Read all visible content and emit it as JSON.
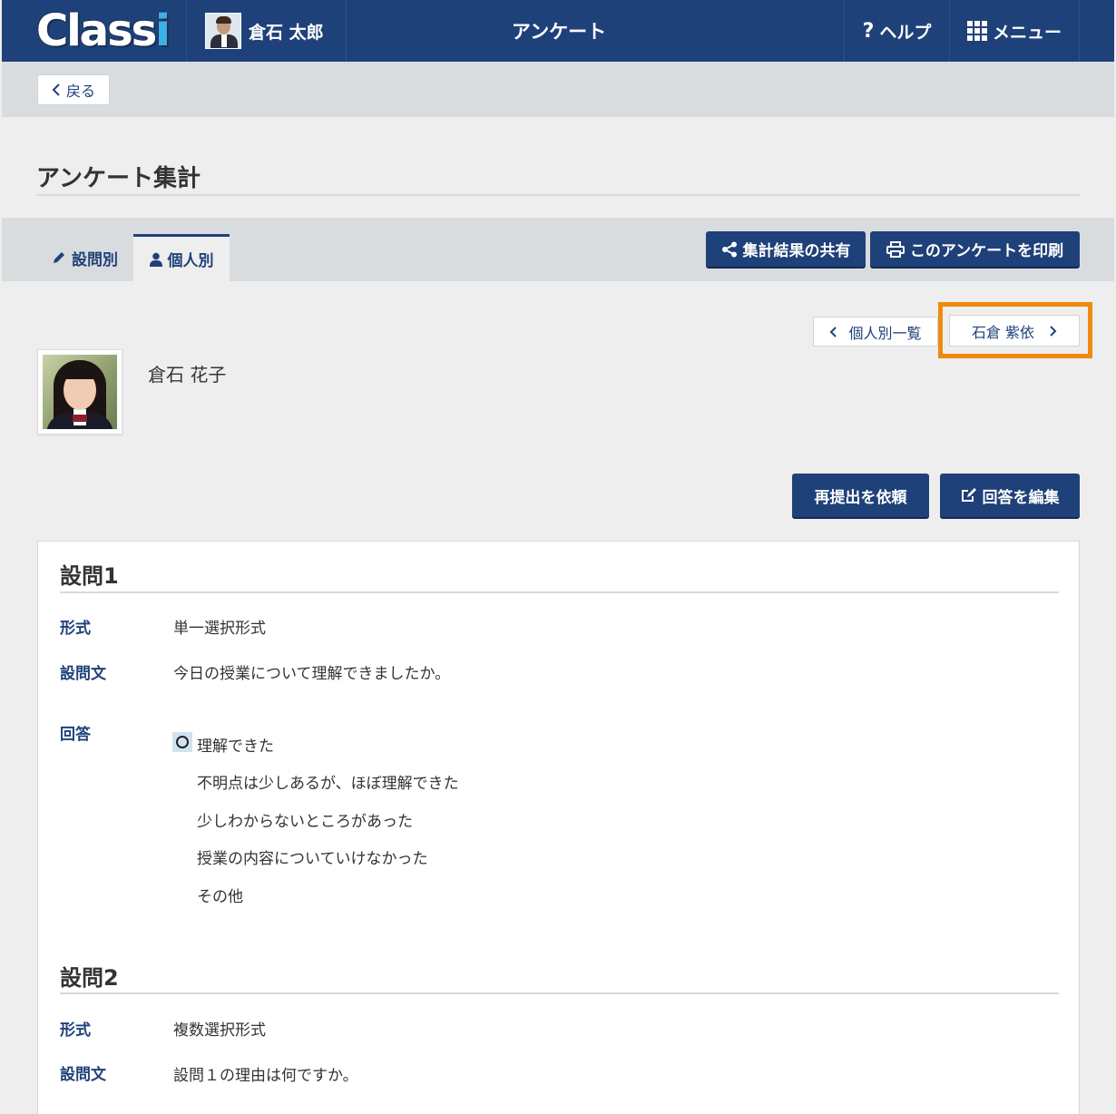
{
  "header": {
    "logo_text_a": "Class",
    "logo_text_b": "i",
    "user_name": "倉石 太郎",
    "page_title": "アンケート",
    "help_icon": "?",
    "help_label": "ヘルプ",
    "menu_label": "メニュー"
  },
  "nav": {
    "back_label": "戻る"
  },
  "page": {
    "title": "アンケート集計"
  },
  "tabs": [
    {
      "label": "設問別",
      "icon": "pencil-icon"
    },
    {
      "label": "個人別",
      "icon": "user-icon"
    }
  ],
  "toolbar": {
    "share_label": "集計結果の共有",
    "print_label": "このアンケートを印刷"
  },
  "pager": {
    "list_label": "個人別一覧",
    "next_label": "石倉 紫依"
  },
  "student": {
    "name": "倉石 花子"
  },
  "actions": {
    "resubmit_label": "再提出を依頼",
    "edit_label": "回答を編集"
  },
  "labels": {
    "format": "形式",
    "question_text": "設問文",
    "answer": "回答"
  },
  "questions": [
    {
      "title": "設問1",
      "format": "単一選択形式",
      "text": "今日の授業について理解できましたか。",
      "options": [
        "理解できた",
        "不明点は少しあるが、ほぼ理解できた",
        "少しわからないところがあった",
        "授業の内容についていけなかった",
        "その他"
      ],
      "selected_index": 0
    },
    {
      "title": "設問2",
      "format": "複数選択形式",
      "text": "設問１の理由は何ですか。"
    }
  ],
  "colors": {
    "primary": "#1f4179",
    "highlight": "#ee8a0c",
    "selected_bg": "#cfe3f1"
  }
}
